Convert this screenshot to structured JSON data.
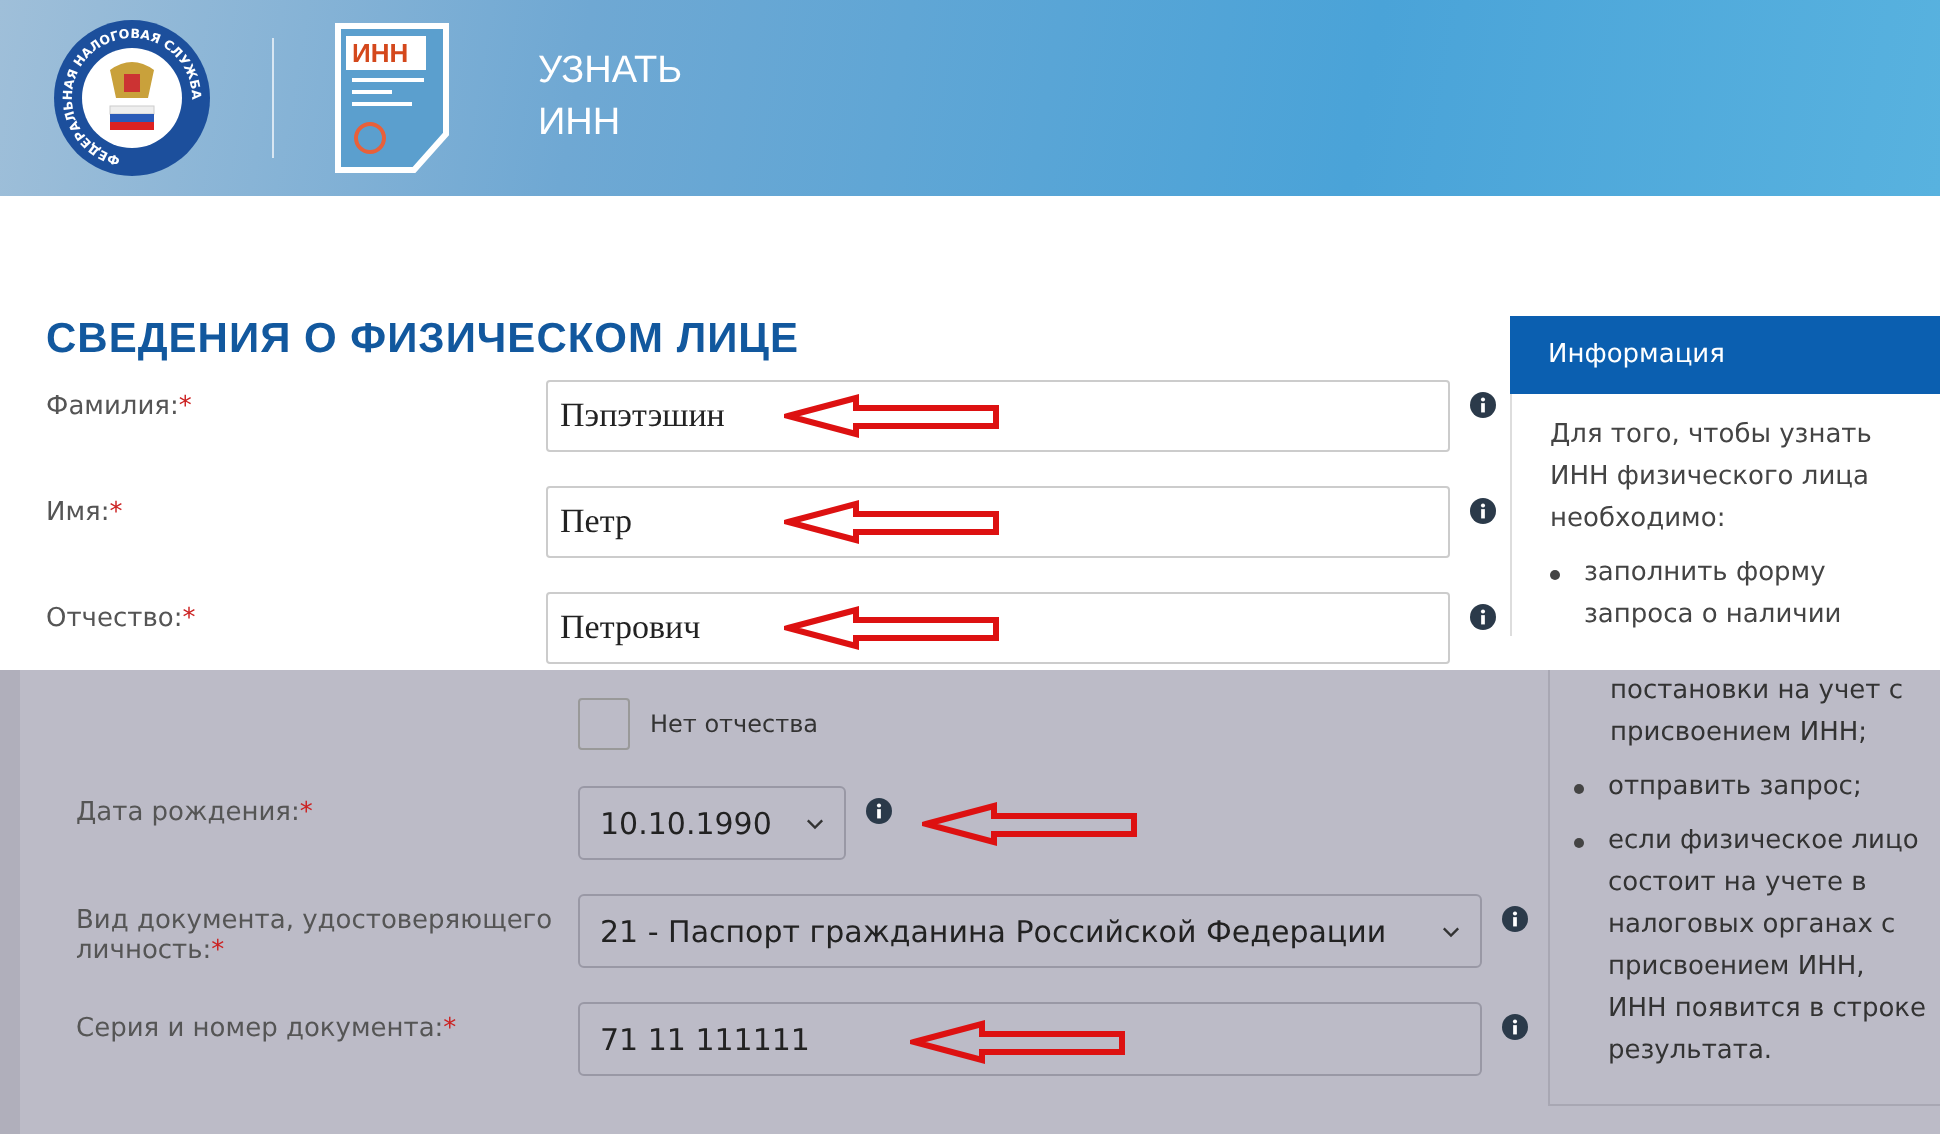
{
  "header": {
    "emblem_text": "ФЕДЕРАЛЬНАЯ НАЛОГОВАЯ СЛУЖБА",
    "doc_icon_text": "ИНН",
    "title": "УЗНАТЬ ИНН"
  },
  "section_title": "СВЕДЕНИЯ О ФИЗИЧЕСКОМ ЛИЦЕ",
  "top_fields": [
    {
      "kind": "text",
      "label": "Фамилия:",
      "required_mark": "*",
      "value": "Пэпэтэшин",
      "arrow": true
    },
    {
      "kind": "text",
      "label": "Имя:",
      "required_mark": "*",
      "value": "Петр",
      "arrow": true
    },
    {
      "kind": "text",
      "label": "Отчество:",
      "required_mark": "*",
      "value": "Петрович",
      "arrow": true
    }
  ],
  "bottom_fields": [
    {
      "kind": "checkbox",
      "label": "Нет отчества",
      "checked": false
    },
    {
      "kind": "date",
      "label": "Дата рождения:",
      "required_mark": "*",
      "value": "10.10.1990",
      "arrow": true
    },
    {
      "kind": "select",
      "label": "Вид документа, удостоверяющего личность:",
      "required_mark": "*",
      "value": "21 - Паспорт гражданина Российской Федерации",
      "arrow": false
    },
    {
      "kind": "text",
      "label": "Серия и номер документа:",
      "required_mark": "*",
      "value": "71 11 111111",
      "arrow": true
    }
  ],
  "info": {
    "title": "Информация",
    "intro": "Для того, чтобы узнать ИНН физического лица необходимо:",
    "first_bullet_start": "заполнить форму запроса о наличии",
    "first_bullet_end": "постановки на учет с присвоением ИНН;",
    "bullets": [
      "отправить запрос;",
      "если физическое лицо состоит на учете в налоговых органах с присвоением ИНН, ИНН появится в строке результата."
    ]
  }
}
